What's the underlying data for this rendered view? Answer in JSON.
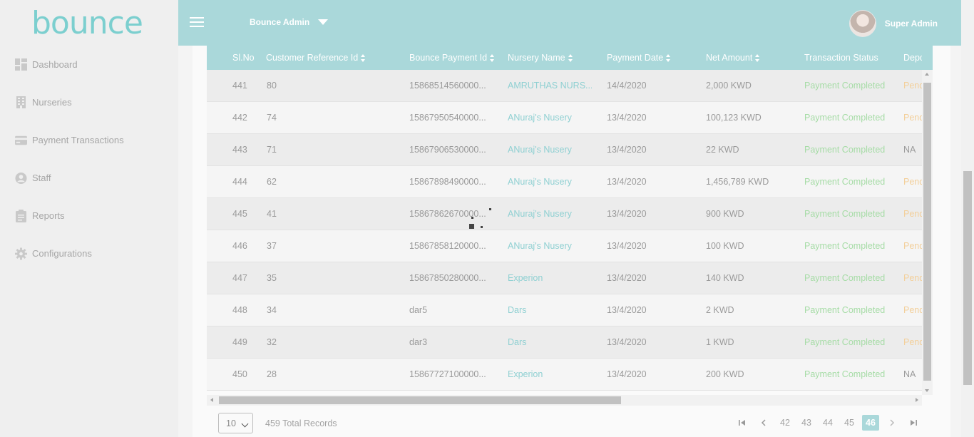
{
  "brand": {
    "logo_text": "bounce",
    "accent": "#aad8da"
  },
  "header": {
    "admin_label": "Bounce Admin",
    "user_name": "Super Admin"
  },
  "sidebar": {
    "items": [
      {
        "label": "Dashboard",
        "icon": "dashboard-icon"
      },
      {
        "label": "Nurseries",
        "icon": "building-icon"
      },
      {
        "label": "Payment Transactions",
        "icon": "credit-card-icon"
      },
      {
        "label": "Staff",
        "icon": "user-circle-icon"
      },
      {
        "label": "Reports",
        "icon": "clipboard-icon"
      },
      {
        "label": "Configurations",
        "icon": "gear-icon"
      }
    ]
  },
  "table": {
    "columns": [
      "Sl.No",
      "Customer Reference Id",
      "Bounce Payment Id",
      "Nursery Name",
      "Payment Date",
      "Net Amount",
      "Transaction Status",
      "Deposit"
    ],
    "rows": [
      {
        "sl": "441",
        "ref": "80",
        "pay": "15868514560000...",
        "nursery": "AMRUTHAS NURS...",
        "date": "14/4/2020",
        "amount": "2,000 KWD",
        "status": "Payment Completed",
        "deposit": "Pend",
        "deposit_state": "pend"
      },
      {
        "sl": "442",
        "ref": "74",
        "pay": "15867950540000...",
        "nursery": "ANuraj's Nusery",
        "date": "13/4/2020",
        "amount": "100,123 KWD",
        "status": "Payment Completed",
        "deposit": "Pend",
        "deposit_state": "pend"
      },
      {
        "sl": "443",
        "ref": "71",
        "pay": "15867906530000...",
        "nursery": "ANuraj's Nusery",
        "date": "13/4/2020",
        "amount": "22 KWD",
        "status": "Payment Completed",
        "deposit": "NA",
        "deposit_state": "na"
      },
      {
        "sl": "444",
        "ref": "62",
        "pay": "15867898490000...",
        "nursery": "ANuraj's Nusery",
        "date": "13/4/2020",
        "amount": "1,456,789 KWD",
        "status": "Payment Completed",
        "deposit": "Pend",
        "deposit_state": "pend"
      },
      {
        "sl": "445",
        "ref": "41",
        "pay": "15867862670000...",
        "nursery": "ANuraj's Nusery",
        "date": "13/4/2020",
        "amount": "900 KWD",
        "status": "Payment Completed",
        "deposit": "Pend",
        "deposit_state": "pend"
      },
      {
        "sl": "446",
        "ref": "37",
        "pay": "15867858120000...",
        "nursery": "ANuraj's Nusery",
        "date": "13/4/2020",
        "amount": "100 KWD",
        "status": "Payment Completed",
        "deposit": "Pend",
        "deposit_state": "pend"
      },
      {
        "sl": "447",
        "ref": "35",
        "pay": "15867850280000...",
        "nursery": "Experion",
        "date": "13/4/2020",
        "amount": "140 KWD",
        "status": "Payment Completed",
        "deposit": "Pend",
        "deposit_state": "pend"
      },
      {
        "sl": "448",
        "ref": "34",
        "pay": "dar5",
        "nursery": "Dars",
        "date": "13/4/2020",
        "amount": "2 KWD",
        "status": "Payment Completed",
        "deposit": "Pend",
        "deposit_state": "pend"
      },
      {
        "sl": "449",
        "ref": "32",
        "pay": "dar3",
        "nursery": "Dars",
        "date": "13/4/2020",
        "amount": "1 KWD",
        "status": "Payment Completed",
        "deposit": "Pend",
        "deposit_state": "pend"
      },
      {
        "sl": "450",
        "ref": "28",
        "pay": "15867727100000...",
        "nursery": "Experion",
        "date": "13/4/2020",
        "amount": "200 KWD",
        "status": "Payment Completed",
        "deposit": "NA",
        "deposit_state": "na"
      }
    ]
  },
  "footer": {
    "page_size": "10",
    "total_records": "459 Total Records",
    "pages": [
      "42",
      "43",
      "44",
      "45",
      "46"
    ],
    "active_page": "46"
  }
}
